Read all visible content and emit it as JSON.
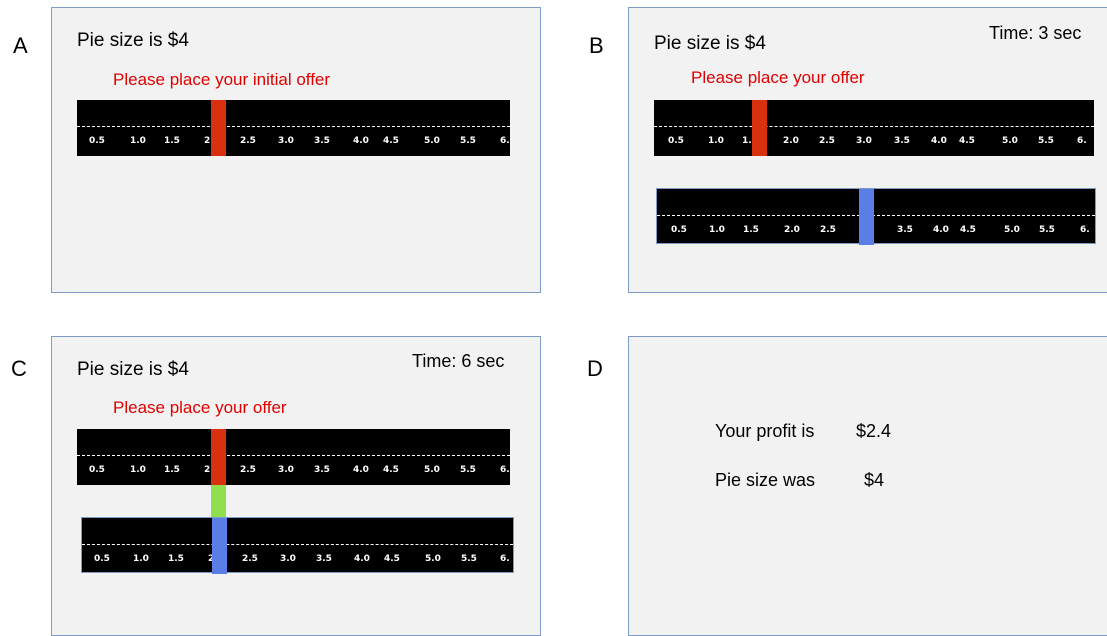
{
  "panels": {
    "a": {
      "letter": "A",
      "title": "Pie size is $4",
      "prompt": "Please place your initial offer",
      "ticks": [
        "0.5",
        "1.0",
        "1.5",
        "2.",
        "2.5",
        "3.0",
        "3.5",
        "4.0",
        "4.5",
        "5.0",
        "5.5",
        "6."
      ],
      "offer_handle_color": "#d9310f"
    },
    "b": {
      "letter": "B",
      "title": "Pie size is $4",
      "prompt": "Please place your offer",
      "timer": "Time: 3 sec",
      "ticks_top": [
        "0.5",
        "1.0",
        "1.",
        "2.0",
        "2.5",
        "3.0",
        "3.5",
        "4.0",
        "4.5",
        "5.0",
        "5.5",
        "6."
      ],
      "ticks_bottom": [
        "0.5",
        "1.0",
        "1.5",
        "2.0",
        "2.5",
        "3.5",
        "4.0",
        "4.5",
        "5.0",
        "5.5",
        "6."
      ],
      "offer_handle_color": "#d9310f",
      "counter_handle_color": "#5b7de6"
    },
    "c": {
      "letter": "C",
      "title": "Pie size is $4",
      "prompt": "Please place your offer",
      "timer": "Time: 6 sec",
      "ticks_top": [
        "0.5",
        "1.0",
        "1.5",
        "2.",
        "2.5",
        "3.0",
        "3.5",
        "4.0",
        "4.5",
        "5.0",
        "5.5",
        "6."
      ],
      "ticks_bottom": [
        "0.5",
        "1.0",
        "1.5",
        "2",
        "2.5",
        "3.0",
        "3.5",
        "4.0",
        "4.5",
        "5.0",
        "5.5",
        "6."
      ],
      "offer_handle_color": "#d9310f",
      "match_connector_color": "#8ee04e",
      "counter_handle_color": "#5b7de6"
    },
    "d": {
      "letter": "D",
      "profit_label": "Your profit is",
      "profit_value": "$2.4",
      "pie_label": "Pie size was",
      "pie_value": "$4"
    }
  }
}
